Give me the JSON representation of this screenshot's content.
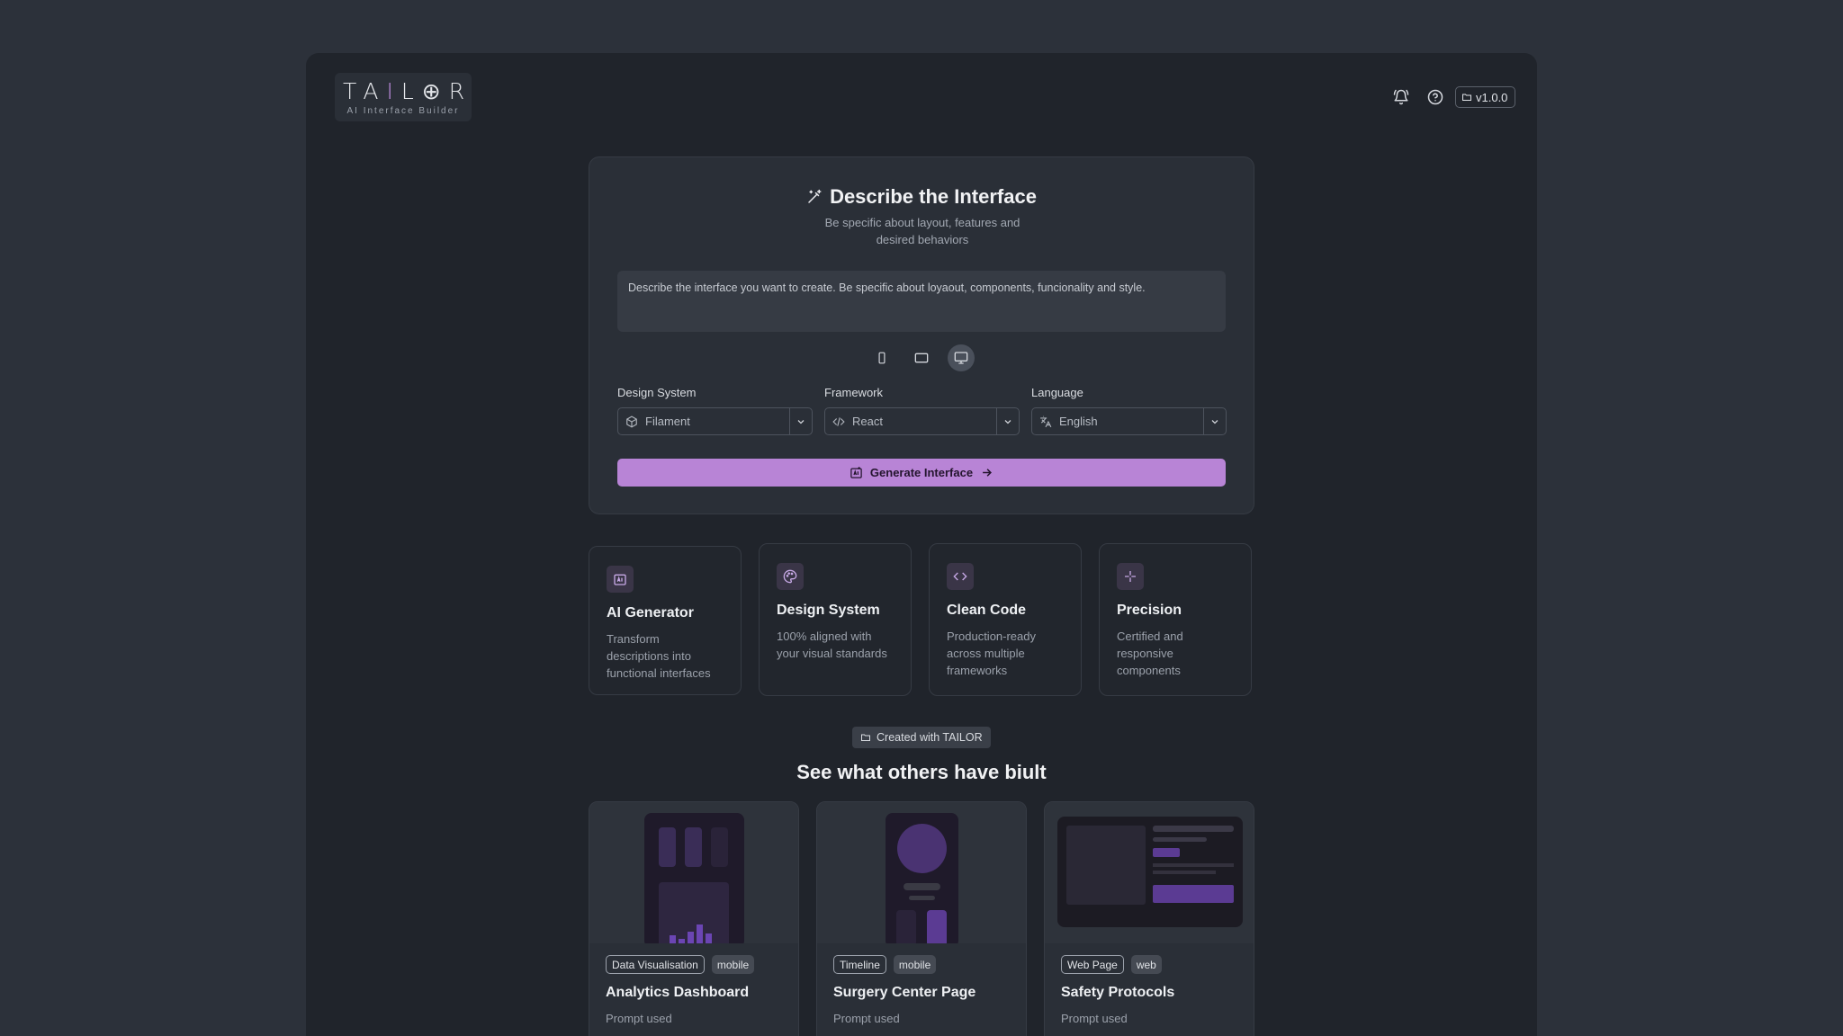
{
  "brand": {
    "name_pre": "TA",
    "name_accent": "I",
    "name_post": "L",
    "name_glyph": "⊕",
    "name_end": "R",
    "tagline": "AI Interface Builder"
  },
  "header": {
    "version": "v1.0.0",
    "icons": [
      "bell-icon",
      "help-icon"
    ]
  },
  "prompt": {
    "title": "Describe the Interface",
    "subtitle": "Be specific about layout, features and desired behaviors",
    "placeholder": "Describe the interface you want to create. Be specific about loyaout, components, funcionality and style.",
    "devices": [
      "mobile",
      "tablet",
      "desktop"
    ],
    "active_device": "desktop",
    "design_system": {
      "label": "Design System",
      "value": "Filament"
    },
    "framework": {
      "label": "Framework",
      "value": "React"
    },
    "language": {
      "label": "Language",
      "value": "English"
    },
    "generate_label": "Generate Interface"
  },
  "features": [
    {
      "title": "AI Generator",
      "desc": "Transform descriptions into functional interfaces"
    },
    {
      "title": "Design System",
      "desc": "100% aligned with your visual standards"
    },
    {
      "title": "Clean Code",
      "desc": "Production-ready across multiple frameworks"
    },
    {
      "title": "Precision",
      "desc": "Certified and responsive components"
    }
  ],
  "gallery": {
    "badge": "Created with TAILOR",
    "title": "See what others have biult",
    "items": [
      {
        "tag1": "Data Visualisation",
        "tag2": "mobile",
        "title": "Analytics Dashboard",
        "prompt_label": "Prompt used"
      },
      {
        "tag1": "Timeline",
        "tag2": "mobile",
        "title": "Surgery Center Page",
        "prompt_label": "Prompt used"
      },
      {
        "tag1": "Web Page",
        "tag2": "web",
        "title": "Safety Protocols",
        "prompt_label": "Prompt used"
      }
    ]
  },
  "colors": {
    "accent": "#b884d6",
    "background": "#2c313a",
    "panel": "#20242b",
    "card": "#2a2f37"
  }
}
